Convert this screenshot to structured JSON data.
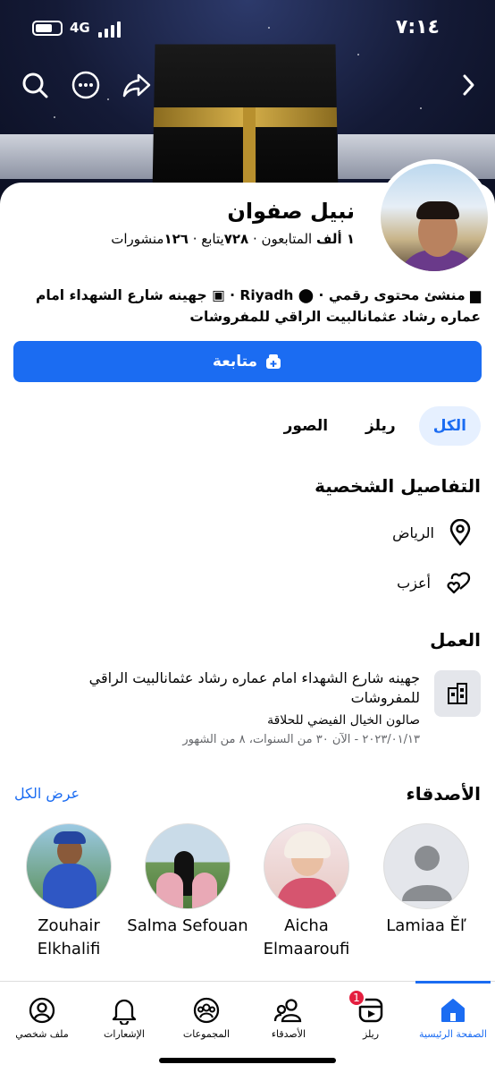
{
  "status_bar": {
    "time": "٧:١٤",
    "network": "4G"
  },
  "profile": {
    "name": "نبيل صفوان",
    "followers_count": "١ ألف",
    "followers_label": "المتابعون",
    "following_count": "٧٢٨",
    "following_label": "يتابع",
    "posts_count": "١٢٦",
    "posts_label": "منشورات",
    "info_line": "منشئ محتوى رقمي · Riyadh · جهينه شارع الشهداء امام عماره رشاد عثمانالبيت الراقي للمفروشات",
    "category": "منشئ محتوى رقمي",
    "city": "Riyadh",
    "workplace": "جهينه شارع الشهداء امام عماره رشاد عثمانالبيت الراقي للمفروشات"
  },
  "follow_button": {
    "label": "متابعة"
  },
  "tabs": [
    {
      "label": "الكل",
      "active": true
    },
    {
      "label": "ريلز",
      "active": false
    },
    {
      "label": "الصور",
      "active": false
    }
  ],
  "details": {
    "title": "التفاصيل الشخصية",
    "location": "الرياض",
    "relationship": "أعزب"
  },
  "work": {
    "title": "العمل",
    "place": "جهينه شارع الشهداء امام عماره رشاد عثمانالبيت الراقي للمفروشات",
    "employer": "صالون الخيال الفيضي للحلاقة",
    "period": "٢٠٢٣/٠١/١٣ - الآن ٣٠ من السنوات، ٨ من الشهور"
  },
  "friends": {
    "title": "الأصدقاء",
    "see_all": "عرض الكل",
    "list": [
      {
        "name": "Lamiaa Ěľ"
      },
      {
        "name": "Aicha Elmaaroufi"
      },
      {
        "name": "Salma Sefouan"
      },
      {
        "name": "Zouhair Elkhalifi"
      }
    ]
  },
  "bottom_nav": {
    "items": [
      {
        "label": "الصفحة الرئيسية",
        "icon": "home-icon",
        "active": true
      },
      {
        "label": "ريلز",
        "icon": "reels-icon",
        "badge": "1"
      },
      {
        "label": "الأصدقاء",
        "icon": "friends-icon"
      },
      {
        "label": "المجموعات",
        "icon": "groups-icon"
      },
      {
        "label": "الإشعارات",
        "icon": "bell-icon"
      },
      {
        "label": "ملف شخصي",
        "icon": "profile-icon"
      }
    ]
  },
  "colors": {
    "accent": "#1b6cf2",
    "badge": "#e41e3f"
  }
}
